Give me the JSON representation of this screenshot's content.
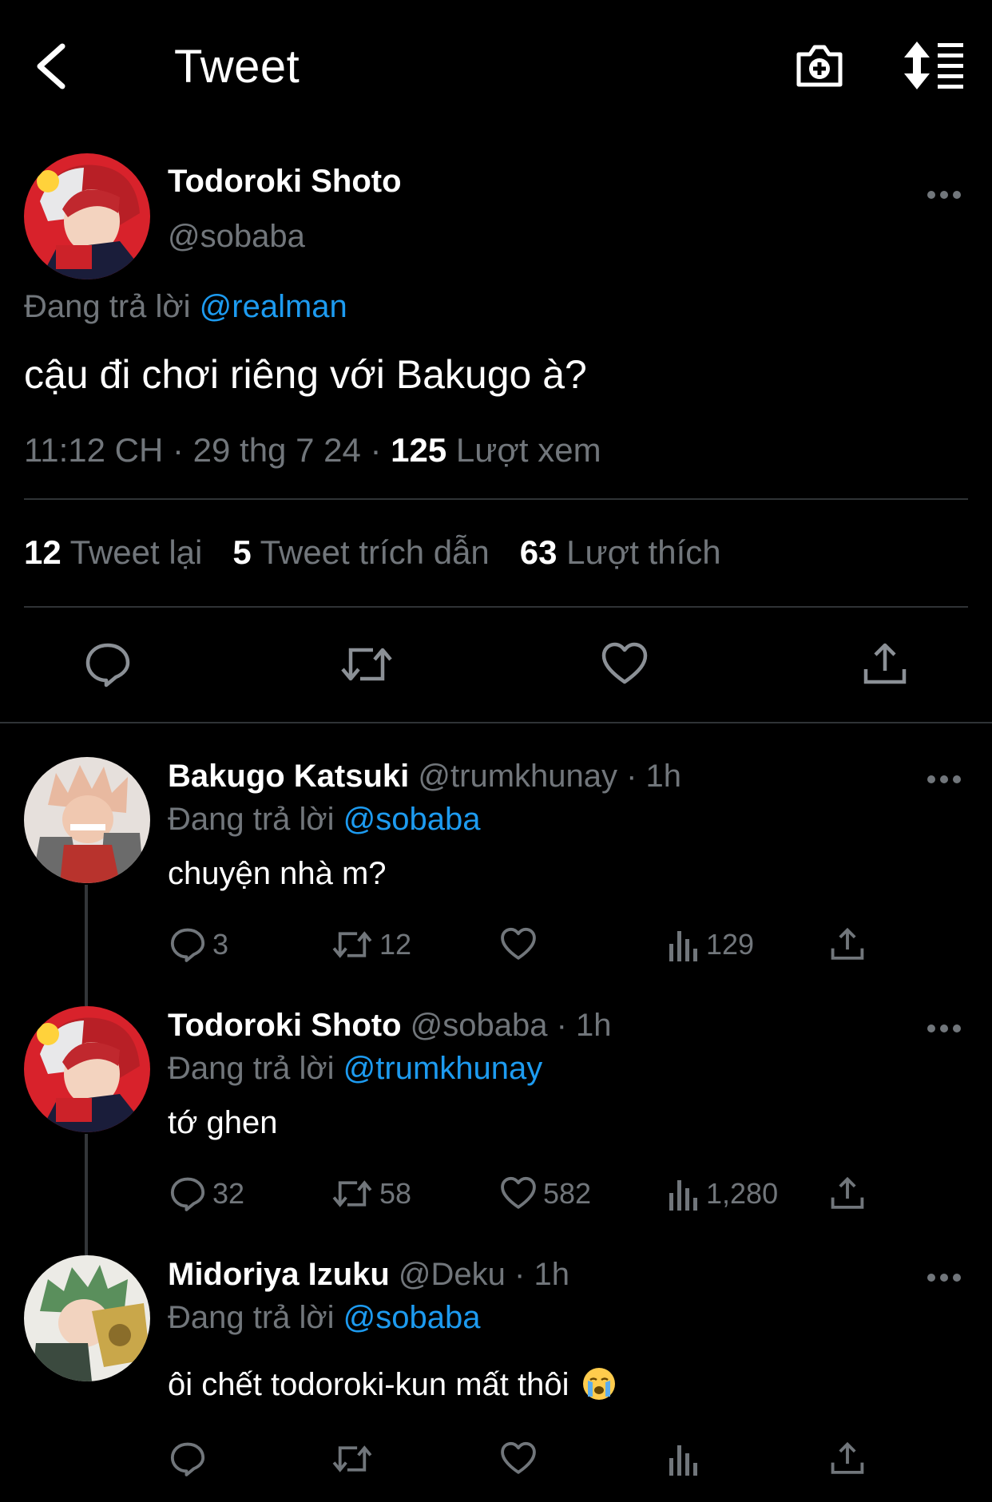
{
  "header": {
    "title": "Tweet"
  },
  "main_tweet": {
    "name": "Todoroki Shoto",
    "handle": "@sobaba",
    "reply_prefix": "Đang trả lời",
    "reply_to": "@realman",
    "text": "cậu đi chơi riêng với Bakugo à?",
    "time": "11:12 CH · 29 thg 7 24 · ",
    "views_count": "125",
    "views_label": " Lượt xem",
    "retweets_count": "12",
    "retweets_label": " Tweet lại",
    "quotes_count": "5",
    "quotes_label": " Tweet trích dẫn",
    "likes_count": "63",
    "likes_label": " Lượt thích"
  },
  "replies": [
    {
      "name": "Bakugo Katsuki",
      "handle_time": " @trumkhunay · 1h",
      "reply_prefix": "Đang trả lời ",
      "reply_to": "@sobaba",
      "text": "chuyện nhà m?",
      "replies": "3",
      "retweets": "12",
      "likes": "",
      "views": "129"
    },
    {
      "name": "Todoroki Shoto",
      "handle_time": " @sobaba · 1h",
      "reply_prefix": "Đang trả lời ",
      "reply_to": "@trumkhunay",
      "text": "tớ ghen",
      "replies": "32",
      "retweets": "58",
      "likes": "582",
      "views": "1,280"
    },
    {
      "name": "Midoriya Izuku",
      "handle_time": " @Deku · 1h",
      "reply_prefix": "Đang trả lời ",
      "reply_to": "@sobaba",
      "text": "ôi chết todoroki-kun mất thôi",
      "replies": "",
      "retweets": "",
      "likes": "",
      "views": ""
    }
  ],
  "colors": {
    "background": "#000000",
    "text": "#e7e9ea",
    "secondary": "#71767b",
    "accent": "#1d9bf0",
    "divider": "#2f3336"
  },
  "icons": [
    "back-arrow-icon",
    "camera-plus-icon",
    "sort-icon",
    "more-icon",
    "reply-icon",
    "retweet-icon",
    "like-icon",
    "views-icon",
    "share-icon",
    "crying-emoji-icon"
  ]
}
